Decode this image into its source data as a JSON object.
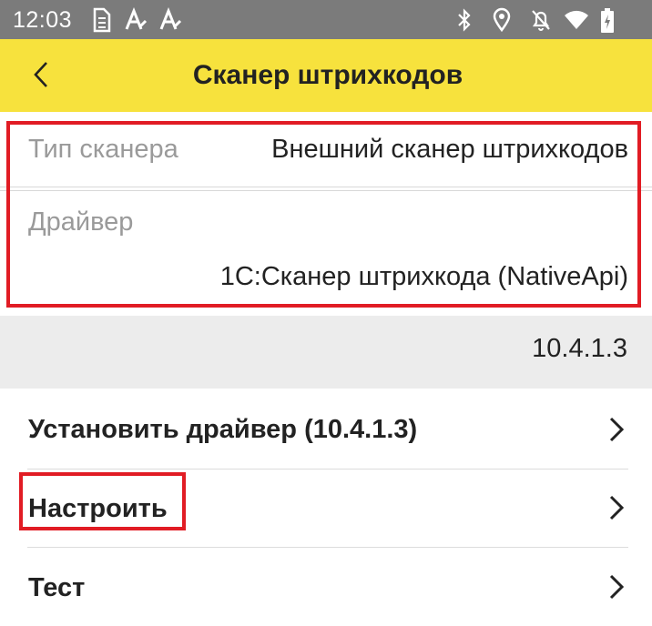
{
  "status_bar": {
    "time": "12:03",
    "left_icons": [
      "sim-icon",
      "font-a-icon",
      "font-a-icon"
    ],
    "right_icons": [
      "bluetooth-icon",
      "location-icon",
      "notifications-off-icon",
      "wifi-icon",
      "battery-charging-icon"
    ]
  },
  "app_bar": {
    "title": "Сканер штрихкодов",
    "back_icon": "back-arrow-icon",
    "color": "#f7e23d"
  },
  "fields": {
    "scanner_type": {
      "label": "Тип сканера",
      "value": "Внешний сканер штрихкодов"
    },
    "driver": {
      "label": "Драйвер",
      "value": "1C:Сканер штрихкода (NativeApi)"
    }
  },
  "version": "10.4.1.3",
  "menu": [
    {
      "label": "Установить драйвер (10.4.1.3)",
      "icon": "chevron-right-icon"
    },
    {
      "label": "Настроить",
      "icon": "chevron-right-icon"
    },
    {
      "label": "Тест",
      "icon": "chevron-right-icon"
    }
  ],
  "colors": {
    "status_bar": "#7b7b7b",
    "highlight": "#e11c24",
    "version_band": "#ececec"
  }
}
